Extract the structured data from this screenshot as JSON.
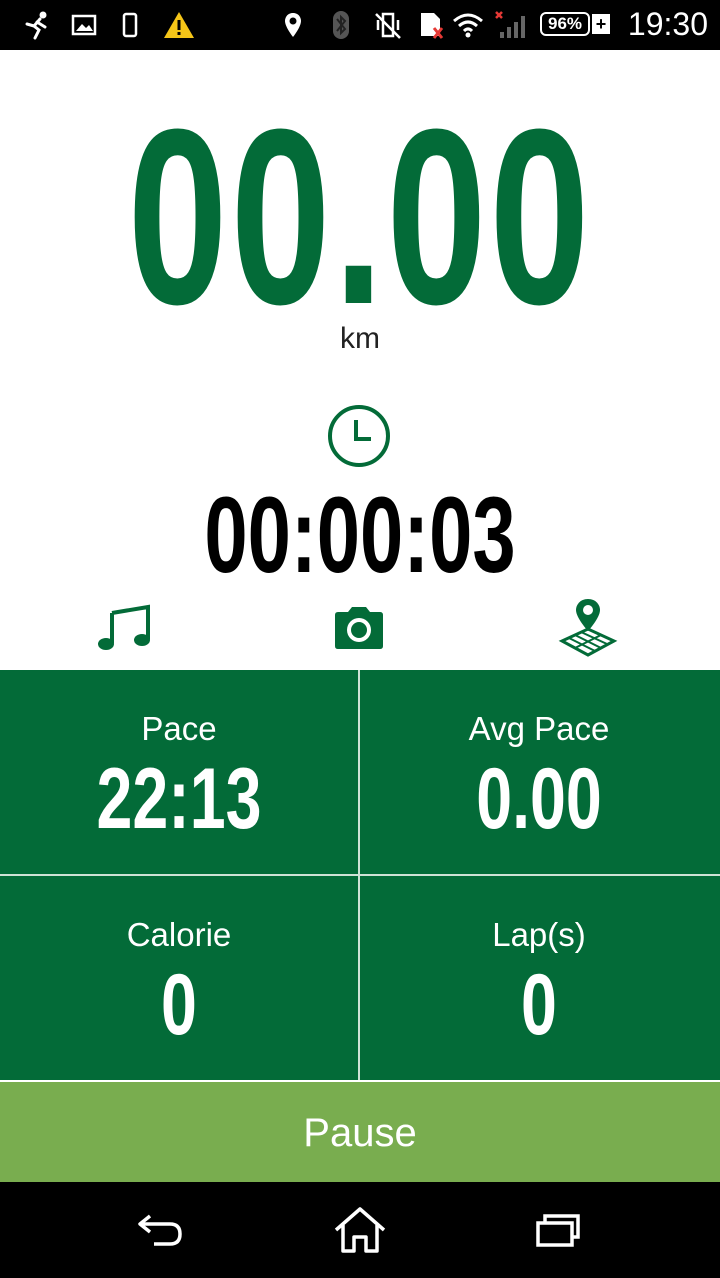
{
  "status_bar": {
    "time": "19:30",
    "battery": "96%",
    "icons": [
      "running-icon",
      "image-icon",
      "phone-icon",
      "warning-icon",
      "location-icon",
      "bluetooth-icon",
      "vibrate-off-icon",
      "sim-x-icon",
      "wifi-icon",
      "signal-icon",
      "battery-icon",
      "charging-icon"
    ]
  },
  "distance": {
    "value": "00.00",
    "unit": "km"
  },
  "timer": {
    "elapsed": "00:00:03",
    "icon": "clock-icon"
  },
  "actions": [
    {
      "icon": "music-icon"
    },
    {
      "icon": "camera-icon"
    },
    {
      "icon": "map-pin-icon"
    }
  ],
  "stats": {
    "pace": {
      "label": "Pace",
      "value": "22:13"
    },
    "avg_pace": {
      "label": "Avg Pace",
      "value": "0.00"
    },
    "calorie": {
      "label": "Calorie",
      "value": "0"
    },
    "laps": {
      "label": "Lap(s)",
      "value": "0"
    }
  },
  "pause_button": {
    "label": "Pause"
  },
  "nav": {
    "icons": [
      "back-icon",
      "home-icon",
      "recents-icon"
    ]
  },
  "colors": {
    "primary": "#036b38",
    "pause": "#79ad4f"
  }
}
